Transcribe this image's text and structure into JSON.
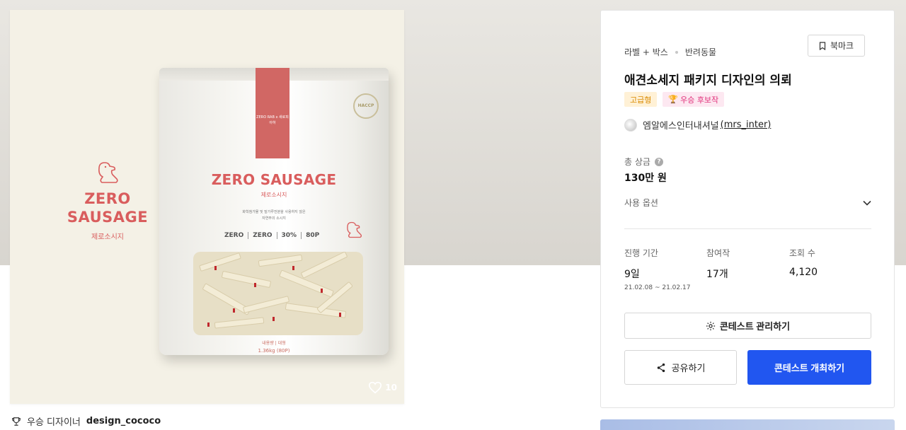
{
  "image": {
    "logo": {
      "line1": "ZERO",
      "line2": "SAUSAGE",
      "sub": "제로소시지"
    },
    "pouch": {
      "ribbon_text": "ZERO RAB x 새로피아하",
      "badge_text": "HACCP",
      "title": "ZERO SAUSAGE",
      "subtitle": "제로소시지",
      "desc_line1": "화학첨가물 및 밀가루전분을 사용하지 않은",
      "desc_line2": "자연주의 소시지",
      "stats": [
        "ZERO",
        "ZERO",
        "30%",
        "80P"
      ],
      "weight_label": "내용량 | 대형",
      "weight": "1.36kg (80P)"
    },
    "likes": "10"
  },
  "winner": {
    "label": "우승 디자이너",
    "name": "design_cococo"
  },
  "info": {
    "category": "라벨 + 박스",
    "subcategory": "반려동물",
    "bookmark_label": "북마크",
    "title": "애견소세지 패키지 디자인의 의뢰",
    "badge_level": "고급형",
    "badge_award": "우승 후보작",
    "host_name": "엠알에스인터내셔널",
    "host_id": "(mrs_inter)",
    "prize_label": "총 상금",
    "prize_value": "130만 원",
    "options_label": "사용 옵션",
    "period_label": "진행 기간",
    "period_value": "9일",
    "period_range": "21.02.08 ~ 21.02.17",
    "participants_label": "참여작",
    "participants_value": "17개",
    "views_label": "조회 수",
    "views_value": "4,120",
    "manage_label": "콘테스트 관리하기",
    "share_label": "공유하기",
    "open_label": "콘테스트 개최하기"
  },
  "colors": {
    "accent": "#2156f0",
    "brand_red": "#d95d5d",
    "award_pink": "#e0307a",
    "level_orange": "#d98a00"
  }
}
